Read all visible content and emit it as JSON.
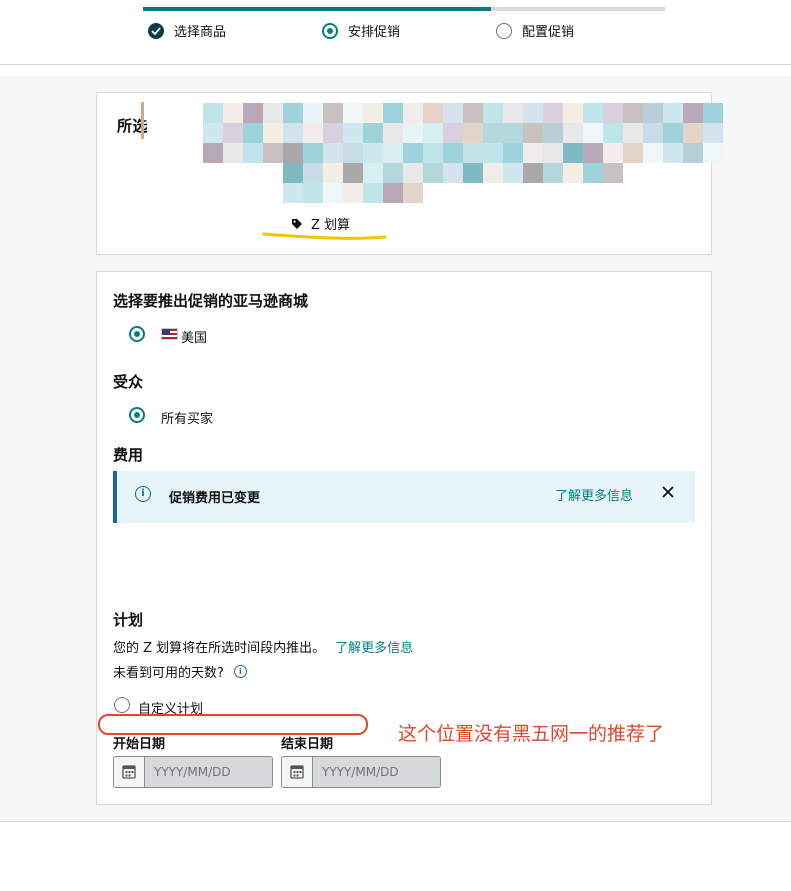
{
  "stepper": {
    "progress_fraction": 0.667,
    "steps": [
      {
        "label": "选择商品",
        "state": "done"
      },
      {
        "label": "安排促销",
        "state": "active"
      },
      {
        "label": "配置促销",
        "state": "todo"
      }
    ]
  },
  "selected_products": {
    "title": "所选",
    "promotion_type": "Z 划算"
  },
  "marketplace": {
    "heading": "选择要推出促销的亚马逊商城",
    "option": "美国"
  },
  "audience": {
    "heading": "受众",
    "option": "所有买家"
  },
  "fees": {
    "heading": "费用",
    "alert_text": "促销费用已变更",
    "alert_link": "了解更多信息"
  },
  "schedule": {
    "heading": "计划",
    "description": "您的 Z 划算将在所选时间段内推出。",
    "description_link": "了解更多信息",
    "question": "未看到可用的天数?",
    "custom_option": "自定义计划",
    "start_label": "开始日期",
    "end_label": "结束日期",
    "start_placeholder": "YYYY/MM/DD",
    "end_placeholder": "YYYY/MM/DD"
  },
  "annotation": {
    "text": "这个位置没有黑五网一的推荐了"
  },
  "colors": {
    "accent": "#067d80",
    "stepper_done": "#0f3a4a",
    "alert_border": "#2162a1",
    "alert_bg": "#e6f5fa",
    "highlight_yellow": "#f3c400",
    "annotation_red": "#e2462e"
  }
}
